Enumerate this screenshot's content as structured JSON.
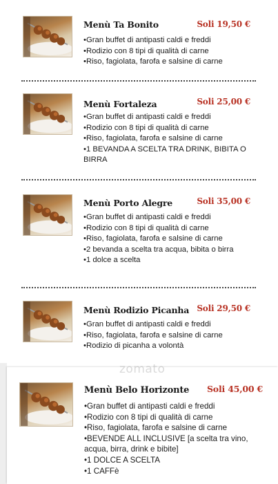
{
  "watermark": "zomato",
  "menus": [
    {
      "title": "Menù Ta Bonito",
      "price": "Soli 19,50 €",
      "items": [
        "•Gran buffet di antipasti caldi e freddi",
        "•Rodizio con 8 tipi di qualità di carne",
        "•Riso, fagiolata, farofa e salsine di carne"
      ]
    },
    {
      "title": "Menù Fortaleza",
      "price": "Soli 25,00 €",
      "items": [
        "•Gran buffet di antipasti caldi e freddi",
        "•Rodizio con 8 tipi di qualità di carne",
        "•Riso, fagiolata, farofa e salsine di carne",
        "•1 BEVANDA A SCELTA TRA DRINK, BIBITA O BIRRA"
      ]
    },
    {
      "title": "Menù Porto Alegre",
      "price": "Soli 35,00 €",
      "items": [
        "•Gran buffet di antipasti caldi e freddi",
        "•Rodizio con 8 tipi di qualità di carne",
        "•Riso, fagiolata, farofa e salsine di carne",
        "•2 bevanda a scelta tra acqua, bibita o birra",
        "•1 dolce a scelta"
      ]
    },
    {
      "title": "Menù Rodizio Picanha",
      "price": "Soli 29,50 €",
      "items": [
        "•Gran buffet di antipasti caldi e freddi",
        "•Riso, fagiolata, farofa e salsine di carne",
        "•Rodizio di picanha a volontà"
      ]
    },
    {
      "title": "Menù Belo Horizonte",
      "price": "Soli 45,00 €",
      "items": [
        "•Gran buffet di antipasti caldi e freddi",
        "•Rodizio con 8 tipi di qualità di carne",
        "•Riso, fagiolata, farofa e salsine di carne",
        "•BEVENDE ALL INCLUSIVE [a scelta tra vino, acqua, birra, drink e bibite]",
        "•1 DOLCE A SCELTA",
        "•1 CAFFè"
      ]
    }
  ]
}
